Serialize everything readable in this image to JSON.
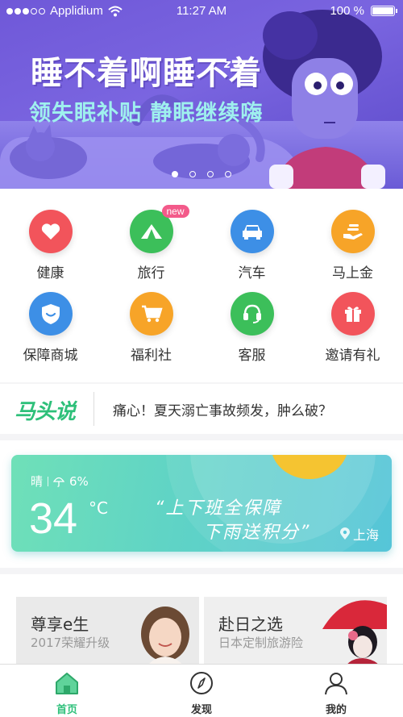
{
  "status_bar": {
    "carrier": "Applidium",
    "time": "11:27 AM",
    "battery": "100 %"
  },
  "banner": {
    "title": "睡不着啊睡不着",
    "zzz": "z z",
    "subtitle": "领失眠补贴  静眠继续嗨",
    "page_count": 4,
    "active_page": 1
  },
  "services": [
    {
      "label": "健康",
      "icon": "heart-icon",
      "color": "#f2545b"
    },
    {
      "label": "旅行",
      "icon": "tent-icon",
      "color": "#3cbf5a",
      "badge": "new"
    },
    {
      "label": "汽车",
      "icon": "car-icon",
      "color": "#3d8fe6"
    },
    {
      "label": "马上金",
      "icon": "coin-hand-icon",
      "color": "#f7a428"
    },
    {
      "label": "保障商城",
      "icon": "shield-smile-icon",
      "color": "#3d8fe6"
    },
    {
      "label": "福利社",
      "icon": "cart-icon",
      "color": "#f7a428"
    },
    {
      "label": "客服",
      "icon": "headset-icon",
      "color": "#3cbf5a"
    },
    {
      "label": "邀请有礼",
      "icon": "gift-icon",
      "color": "#f2545b"
    }
  ],
  "news": {
    "brand": "马头说",
    "headline": "痛心！夏天溺亡事故频发，肿么破？"
  },
  "weather": {
    "condition": "晴",
    "humidity": "6%",
    "temperature": "34",
    "unit": "°C",
    "slogan_line1": "“上下班全保障",
    "slogan_line2": "下雨送积分”",
    "city": "上海"
  },
  "promos": [
    {
      "title": "尊享e生",
      "subtitle": "2017荣耀升级"
    },
    {
      "title": "赴日之选",
      "subtitle": "日本定制旅游险"
    }
  ],
  "tabs": [
    {
      "label": "首页",
      "icon": "home-icon",
      "active": true
    },
    {
      "label": "发现",
      "icon": "compass-icon",
      "active": false
    },
    {
      "label": "我的",
      "icon": "user-icon",
      "active": false
    }
  ],
  "colors": {
    "accent": "#2ec07a",
    "banner": "#6f58d8",
    "weather": "#5fd3c6"
  }
}
